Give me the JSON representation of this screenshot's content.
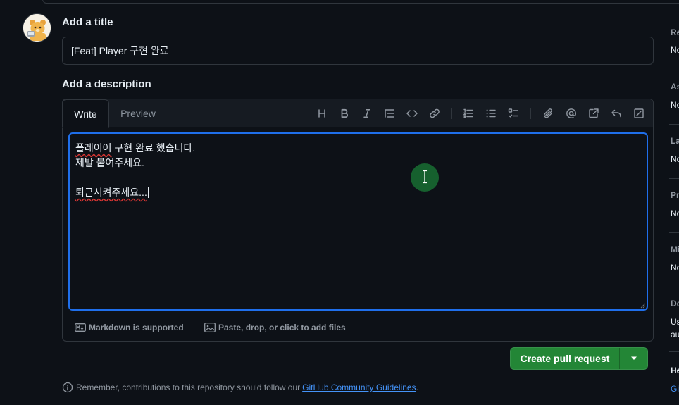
{
  "avatar": {
    "icon": "bear-avatar-icon"
  },
  "title_section": {
    "heading": "Add a title",
    "value": "[Feat] Player 구현 완료"
  },
  "description_section": {
    "heading": "Add a description",
    "tabs": [
      {
        "label": "Write",
        "active": true
      },
      {
        "label": "Preview",
        "active": false
      }
    ],
    "toolbar_icons": [
      "heading-icon",
      "bold-icon",
      "italic-icon",
      "quote-icon",
      "code-icon",
      "link-icon",
      "numbered-list-icon",
      "unordered-list-icon",
      "task-list-icon",
      "paperclip-icon",
      "mention-icon",
      "cross-reference-icon",
      "undo-icon",
      "fullscreen-icon"
    ],
    "body_lines": [
      "플레이어 구현 완료 했습니다.",
      "제발 붙여주세요.",
      "",
      "퇴근시켜주세요..."
    ],
    "footer": {
      "markdown_label": "Markdown is supported",
      "attach_label": "Paste, drop, or click to add files"
    }
  },
  "actions": {
    "create_label": "Create pull request",
    "primary_color": "#238636"
  },
  "note": {
    "text": "Remember, contributions to this repository should follow our",
    "link": "GitHub Community Guidelines",
    "suffix": "."
  },
  "sidebar": {
    "labels": [
      "Re",
      "As",
      "La",
      "Pr",
      "Mi",
      "De",
      "He"
    ],
    "values": [
      "No",
      "No",
      "No",
      "No",
      "No",
      "Us",
      "au",
      "Gi"
    ]
  },
  "colors": {
    "background": "#0d1117",
    "border": "#30363d",
    "accent_focus": "#1f6feb",
    "link": "#4493f8"
  }
}
